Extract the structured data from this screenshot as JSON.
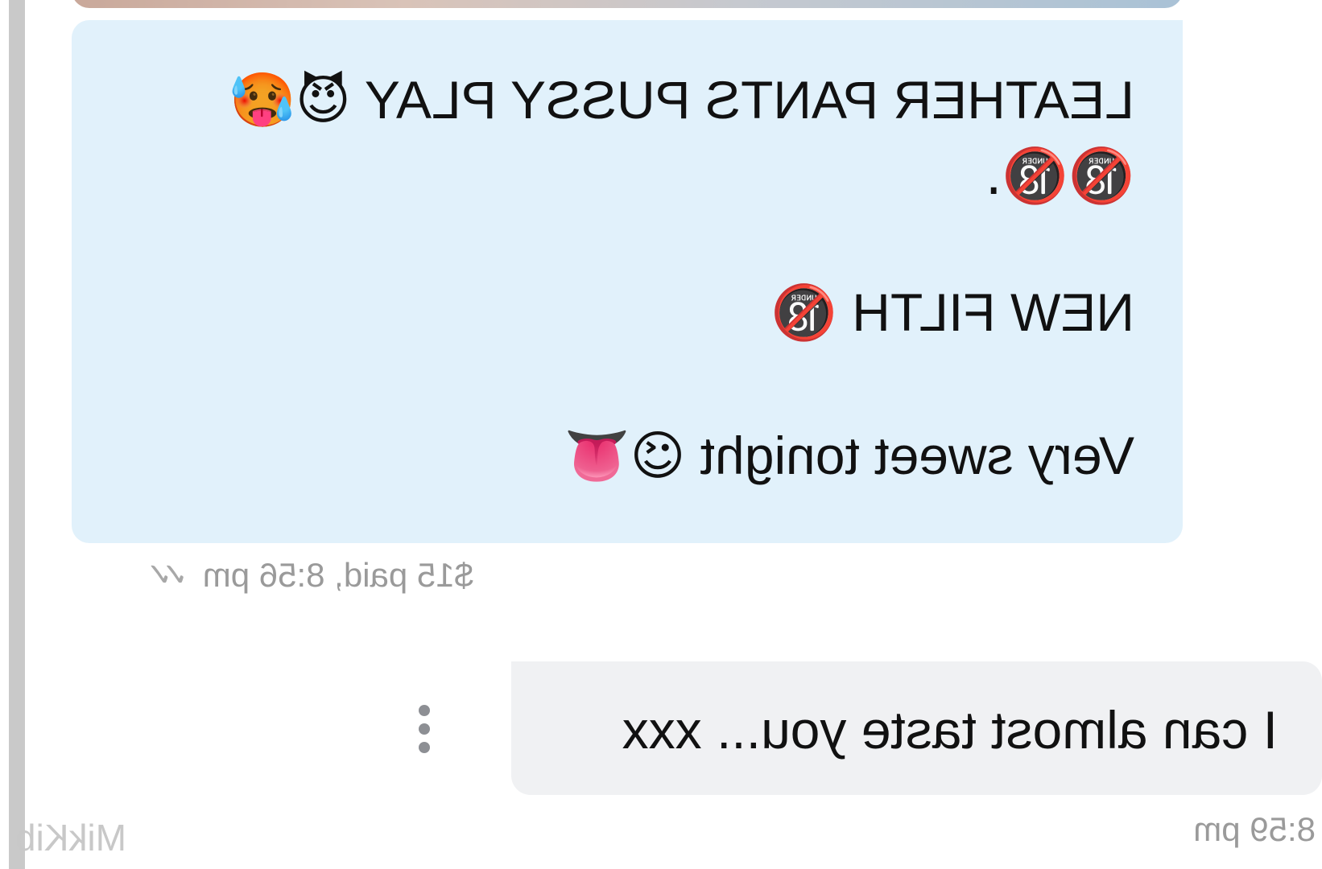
{
  "chat": {
    "incoming": {
      "line1_text": "LEATHER PANTS PUSSY PLAY",
      "line1_emojis": "😈🥵",
      "line2_text": "🔞🔞.",
      "line3_text": "NEW FILTH",
      "line3_emoji": "🔞",
      "line4_text": "Very sweet tonight",
      "line4_emojis": "😉👅",
      "meta": "$15 paid, 8:56 pm",
      "status_ticks": "✓✓"
    },
    "outgoing": {
      "text": "I can almost taste you... xxx",
      "time": "8:59 pm"
    }
  },
  "watermark": "MikKib",
  "colors": {
    "incoming_bubble": "#e1f1fb",
    "outgoing_bubble": "#f0f1f3",
    "meta_text": "#9a9a9a"
  },
  "icons": {
    "more_options": "kebab-menu-icon",
    "read_receipt": "double-check-icon"
  }
}
